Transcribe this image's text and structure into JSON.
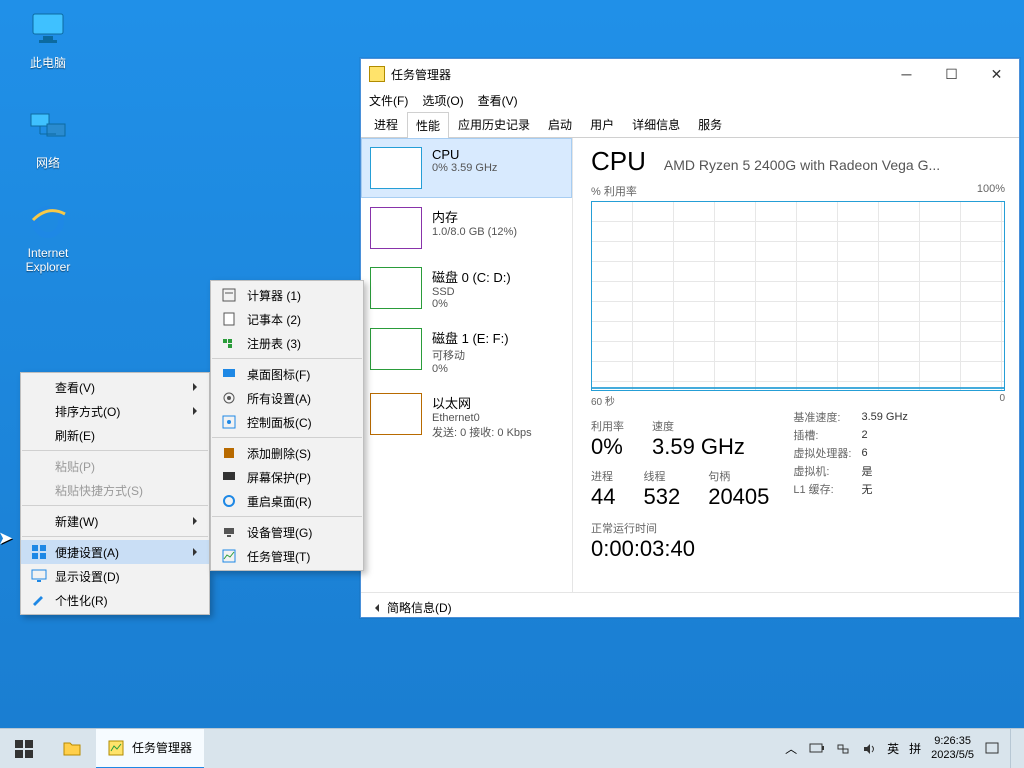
{
  "desktop_icons": {
    "pc": "此电脑",
    "net": "网络",
    "ie_l1": "Internet",
    "ie_l2": "Explorer"
  },
  "ctx1": {
    "view": "查看(V)",
    "sort": "排序方式(O)",
    "refresh": "刷新(E)",
    "paste": "粘贴(P)",
    "paste_shortcut": "粘贴快捷方式(S)",
    "new": "新建(W)",
    "quick": "便捷设置(A)",
    "display": "显示设置(D)",
    "personalize": "个性化(R)"
  },
  "ctx2": {
    "calc": "计算器  (1)",
    "notepad": "记事本  (2)",
    "regedit": "注册表  (3)",
    "deskicon": "桌面图标(F)",
    "allset": "所有设置(A)",
    "ctrlpanel": "控制面板(C)",
    "adddel": "添加删除(S)",
    "screensaver": "屏幕保护(P)",
    "restartdesk": "重启桌面(R)",
    "devmgr": "设备管理(G)",
    "taskmgr": "任务管理(T)"
  },
  "tm": {
    "title": "任务管理器",
    "menu": {
      "file": "文件(F)",
      "options": "选项(O)",
      "view": "查看(V)"
    },
    "tabs": {
      "proc": "进程",
      "perf": "性能",
      "app": "应用历史记录",
      "start": "启动",
      "user": "用户",
      "detail": "详细信息",
      "serv": "服务"
    },
    "cats": [
      {
        "title": "CPU",
        "sub": "0% 3.59 GHz",
        "color": "#259ed6"
      },
      {
        "title": "内存",
        "sub": "1.0/8.0 GB (12%)",
        "color": "#8833aa"
      },
      {
        "title": "磁盘 0 (C: D:)",
        "sub": "SSD\n0%",
        "color": "#2a9c3a"
      },
      {
        "title": "磁盘 1 (E: F:)",
        "sub": "可移动\n0%",
        "color": "#2a9c3a"
      },
      {
        "title": "以太网",
        "sub": "Ethernet0\n发送: 0 接收: 0 Kbps",
        "color": "#b86a00"
      }
    ],
    "right": {
      "head_big": "CPU",
      "head_name": "AMD Ryzen 5 2400G with Radeon Vega G...",
      "sub_left": "% 利用率",
      "sub_right": "100%",
      "x_left": "60 秒",
      "x_right": "0",
      "util_l": "利用率",
      "util_v": "0%",
      "spd_l": "速度",
      "spd_v": "3.59 GHz",
      "proc_l": "进程",
      "proc_v": "44",
      "thr_l": "线程",
      "thr_v": "532",
      "hnd_l": "句柄",
      "hnd_v": "20405",
      "base_l": "基准速度:",
      "base_v": "3.59 GHz",
      "sock_l": "插槽:",
      "sock_v": "2",
      "vproc_l": "虚拟处理器:",
      "vproc_v": "6",
      "vm_l": "虚拟机:",
      "vm_v": "是",
      "l1_l": "L1 缓存:",
      "l1_v": "无",
      "up_l": "正常运行时间",
      "up_v": "0:00:03:40"
    },
    "footer": "简略信息(D)"
  },
  "taskbar": {
    "app": "任务管理器",
    "ime1": "英",
    "ime2": "拼",
    "time": "9:26:35",
    "date": "2023/5/5"
  },
  "chart_data": {
    "type": "line",
    "title": "CPU % 利用率",
    "xlabel": "60 秒",
    "ylabel": "% 利用率",
    "ylim": [
      0,
      100
    ],
    "x": [
      60,
      55,
      50,
      45,
      40,
      35,
      30,
      25,
      20,
      15,
      10,
      5,
      0
    ],
    "series": [
      {
        "name": "CPU",
        "values": [
          0,
          0,
          0,
          0,
          0,
          0,
          0,
          0,
          0,
          0,
          0,
          0,
          0
        ]
      }
    ]
  }
}
